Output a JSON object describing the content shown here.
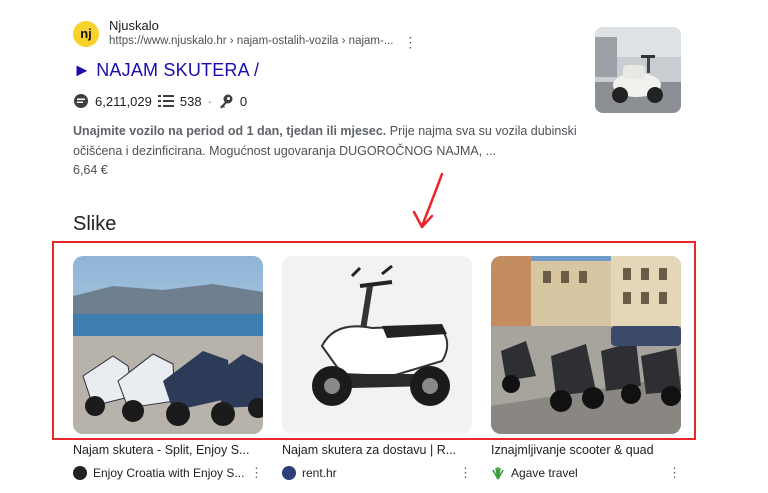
{
  "result": {
    "favicon_text": "nj",
    "site_name": "Njuskalo",
    "url": "https://www.njuskalo.hr › najam-ostalih-vozila › najam-...",
    "title": "► NAJAM SKUTERA /",
    "stats": {
      "views": "6,211,029",
      "ads": "538",
      "keys": "0"
    },
    "snippet_bold": "Unajmite vozilo na period od 1 dan, tjedan ili mjesec.",
    "snippet_rest": " Prije najma sva su vozila dubinski očišćena i dezinficirana. Mogućnost ugovaranja DUGOROČNOG NAJMA, ...",
    "price": "6,64 €"
  },
  "images_section": {
    "title": "Slike",
    "cards": [
      {
        "caption": "Najam skutera - Split, Enjoy S...",
        "source": "Enjoy Croatia with Enjoy S...",
        "source_icon": "enjoy-split-logo"
      },
      {
        "caption": "Najam skutera za dostavu | R...",
        "source": "rent.hr",
        "source_icon": "rent-hr-logo"
      },
      {
        "caption": "Iznajmljivanje scooter & quad",
        "source": "Agave travel",
        "source_icon": "agave-logo"
      }
    ]
  },
  "colors": {
    "link": "#1a0dab",
    "annotation": "#e8262c",
    "favicon": "#f7d22a"
  }
}
